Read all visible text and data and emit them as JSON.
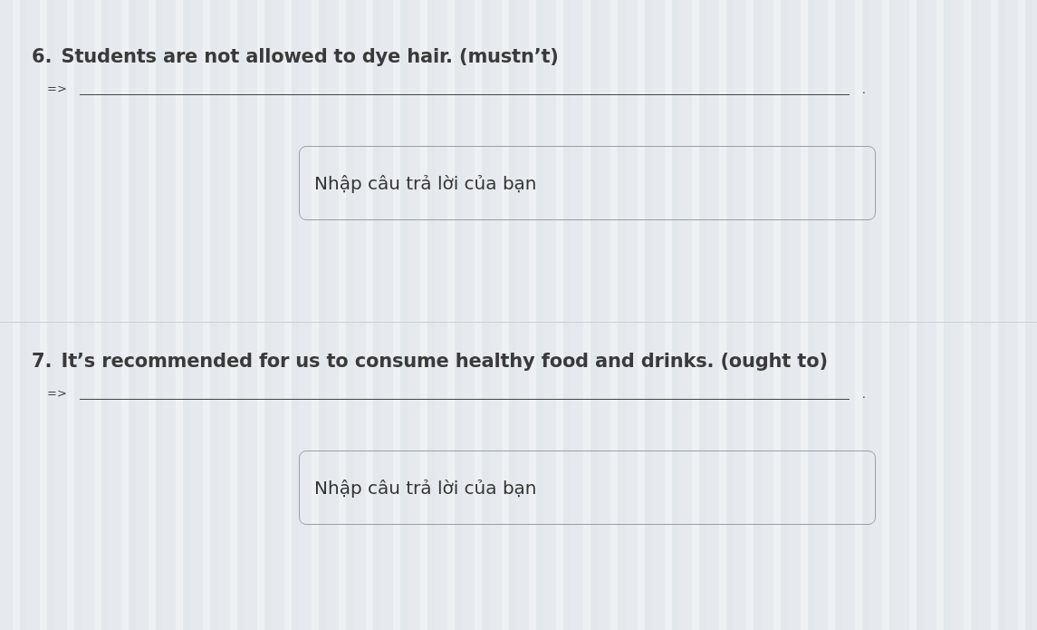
{
  "questions": [
    {
      "number": "6.",
      "text": "Students are not allowed to dye hair. (mustn’t)",
      "arrow": "=>",
      "end_mark": ".",
      "answer": {
        "placeholder": "Nhập câu trả lời của bạn"
      }
    },
    {
      "number": "7.",
      "text": "It’s recommended for us to consume healthy food and drinks. (ought to)",
      "arrow": "=>",
      "end_mark": ".",
      "answer": {
        "placeholder": "Nhập câu trả lời của bạn"
      }
    }
  ]
}
